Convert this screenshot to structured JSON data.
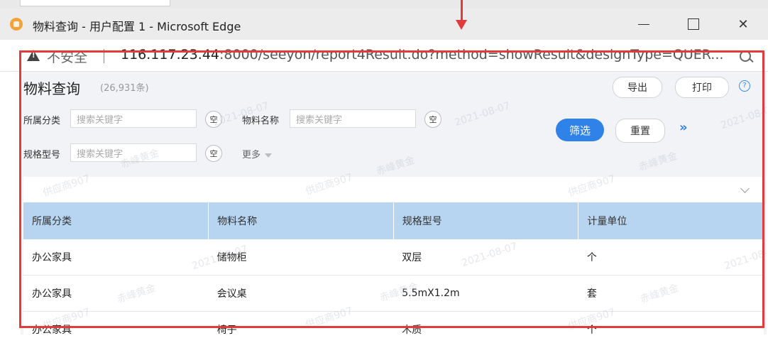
{
  "window": {
    "title": "物料查询 - 用户配置 1 - Microsoft Edge"
  },
  "address_bar": {
    "security_label": "不安全",
    "url_host": "116.117.23.44",
    "url_rest": ":8000/seeyon/report4Result.do?method=showResult&designType=QUER..."
  },
  "page": {
    "title": "物料查询",
    "count": "(26,931条)"
  },
  "toolbar": {
    "export": "导出",
    "print": "打印",
    "help": "?"
  },
  "filters": {
    "category": {
      "label": "所属分类",
      "placeholder": "搜索关键字",
      "clear": "空"
    },
    "name": {
      "label": "物料名称",
      "placeholder": "搜索关键字",
      "clear": "空"
    },
    "spec": {
      "label": "规格型号",
      "placeholder": "搜索关键字",
      "clear": "空"
    },
    "more": "更多",
    "filter_button": "筛选",
    "reset_button": "重置",
    "expand": "»"
  },
  "table": {
    "headers": [
      "所属分类",
      "物料名称",
      "规格型号",
      "计量单位"
    ],
    "rows": [
      [
        "办公家具",
        "储物柜",
        "双层",
        "个"
      ],
      [
        "办公家具",
        "会议桌",
        "5.5mX1.2m",
        "套"
      ],
      [
        "办公家具",
        "椅子",
        "木质",
        "个"
      ]
    ]
  },
  "watermark": {
    "supplier": "供应商907",
    "company": "赤峰黄金",
    "date": "2021-08-07"
  },
  "colors": {
    "accent": "#2f82e8",
    "header_bg": "#b7d5f1",
    "highlight": "#e23b3b"
  }
}
